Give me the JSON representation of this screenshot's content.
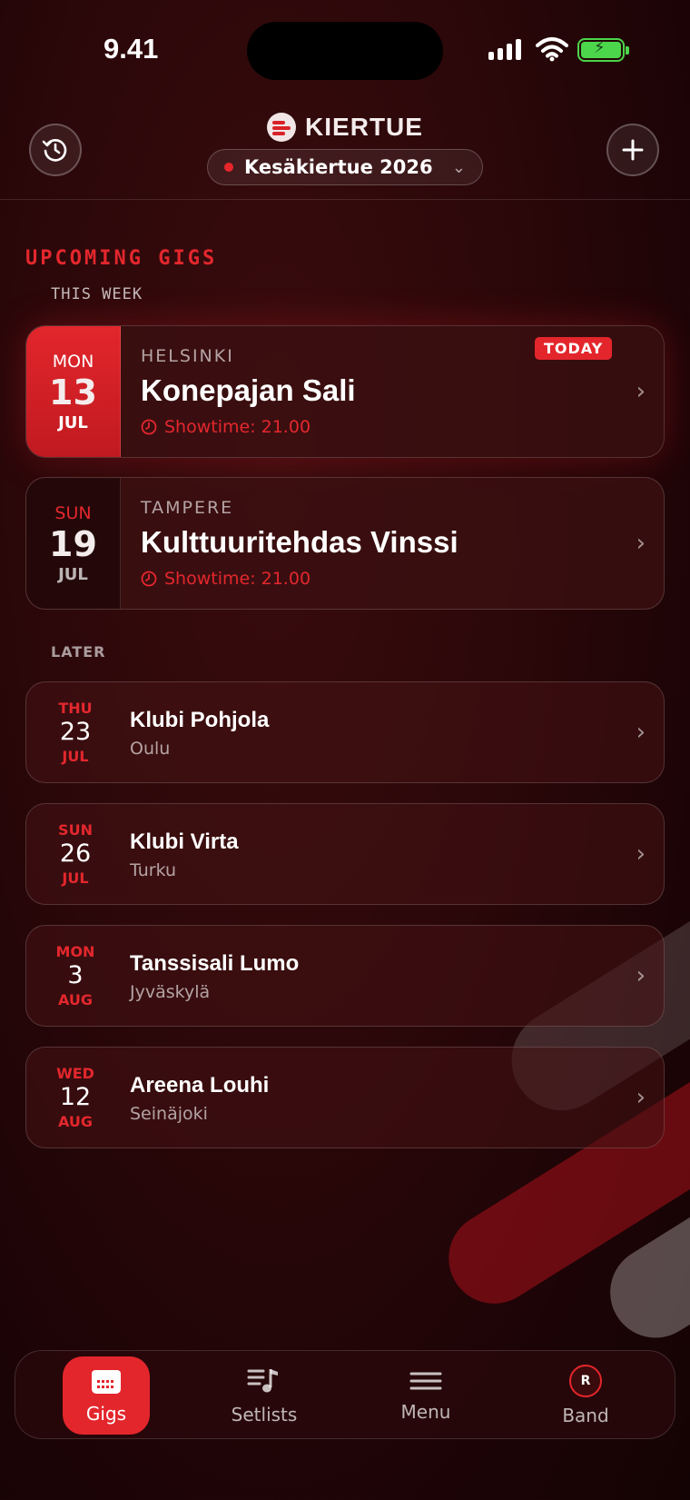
{
  "status_bar": {
    "time": "9.41"
  },
  "header": {
    "brand": "KIERTUE",
    "tour_name": "Kesäkiertue 2026",
    "history_icon": "history-icon",
    "add_icon": "plus-icon"
  },
  "section": {
    "title": "UPCOMING GIGS",
    "this_week_label": "THIS WEEK",
    "later_label": "LATER"
  },
  "this_week": [
    {
      "dow": "MON",
      "day": "13",
      "month": "JUL",
      "city": "HELSINKI",
      "venue": "Konepajan Sali",
      "showtime": "Showtime: 21.00",
      "badge": "TODAY"
    },
    {
      "dow": "SUN",
      "day": "19",
      "month": "JUL",
      "city": "TAMPERE",
      "venue": "Kulttuuritehdas Vinssi",
      "showtime": "Showtime: 21.00"
    }
  ],
  "later": [
    {
      "dow": "THU",
      "day": "23",
      "month": "JUL",
      "venue": "Klubi Pohjola",
      "city": "Oulu"
    },
    {
      "dow": "SUN",
      "day": "26",
      "month": "JUL",
      "venue": "Klubi Virta",
      "city": "Turku"
    },
    {
      "dow": "MON",
      "day": "3",
      "month": "AUG",
      "venue": "Tanssisali Lumo",
      "city": "Jyväskylä"
    },
    {
      "dow": "WED",
      "day": "12",
      "month": "AUG",
      "venue": "Areena Louhi",
      "city": "Seinäjoki"
    }
  ],
  "tabbar": {
    "tabs": [
      {
        "label": "Gigs",
        "icon": "calendar-icon",
        "active": true
      },
      {
        "label": "Setlists",
        "icon": "setlist-icon",
        "active": false
      },
      {
        "label": "Menu",
        "icon": "menu-icon",
        "active": false
      },
      {
        "label": "Band",
        "icon": "avatar",
        "active": false
      }
    ],
    "band_initial": "R"
  },
  "colors": {
    "accent": "#e3262c",
    "background": "#2a0709",
    "battery": "#4bd64b"
  }
}
